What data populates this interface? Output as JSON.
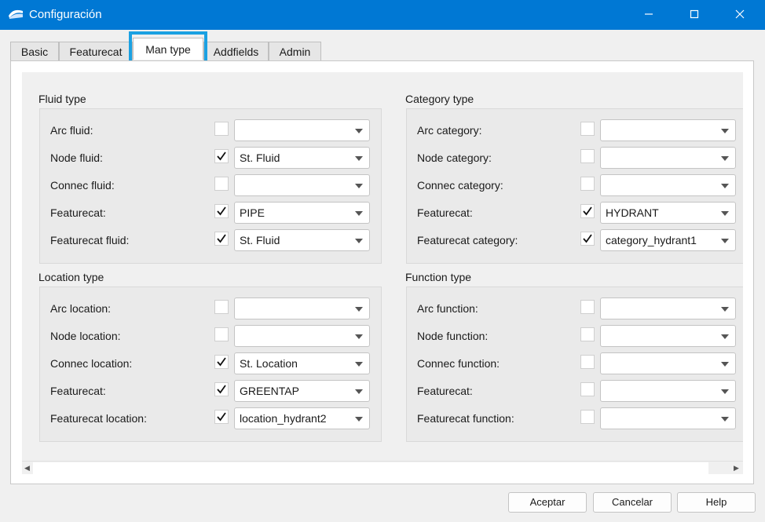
{
  "window": {
    "title": "Configuración",
    "icons": {
      "app": "app-icon",
      "minimize": "minimize-icon",
      "maximize": "maximize-icon",
      "close": "close-icon"
    }
  },
  "tabs": [
    {
      "label": "Basic"
    },
    {
      "label": "Featurecat"
    },
    {
      "label": "Man type",
      "active": true
    },
    {
      "label": "Addfields"
    },
    {
      "label": "Admin"
    }
  ],
  "groups": {
    "fluid": {
      "title": "Fluid type",
      "rows": [
        {
          "label": "Arc fluid:",
          "checked": false,
          "value": ""
        },
        {
          "label": "Node fluid:",
          "checked": true,
          "value": "St. Fluid"
        },
        {
          "label": "Connec fluid:",
          "checked": false,
          "value": ""
        },
        {
          "label": "Featurecat:",
          "checked": true,
          "value": "PIPE"
        },
        {
          "label": "Featurecat fluid:",
          "checked": true,
          "value": "St. Fluid"
        }
      ]
    },
    "category": {
      "title": "Category type",
      "rows": [
        {
          "label": "Arc category:",
          "checked": false,
          "value": ""
        },
        {
          "label": "Node category:",
          "checked": false,
          "value": ""
        },
        {
          "label": "Connec category:",
          "checked": false,
          "value": ""
        },
        {
          "label": "Featurecat:",
          "checked": true,
          "value": "HYDRANT"
        },
        {
          "label": "Featurecat category:",
          "checked": true,
          "value": "category_hydrant1"
        }
      ]
    },
    "location": {
      "title": "Location type",
      "rows": [
        {
          "label": "Arc location:",
          "checked": false,
          "value": ""
        },
        {
          "label": "Node location:",
          "checked": false,
          "value": ""
        },
        {
          "label": "Connec location:",
          "checked": true,
          "value": "St. Location"
        },
        {
          "label": "Featurecat:",
          "checked": true,
          "value": "GREENTAP"
        },
        {
          "label": "Featurecat location:",
          "checked": true,
          "value": "location_hydrant2"
        }
      ]
    },
    "function": {
      "title": "Function type",
      "rows": [
        {
          "label": "Arc function:",
          "checked": false,
          "value": ""
        },
        {
          "label": "Node function:",
          "checked": false,
          "value": ""
        },
        {
          "label": "Connec function:",
          "checked": false,
          "value": ""
        },
        {
          "label": "Featurecat:",
          "checked": false,
          "value": ""
        },
        {
          "label": "Featurecat function:",
          "checked": false,
          "value": ""
        }
      ]
    }
  },
  "buttons": {
    "accept": "Aceptar",
    "cancel": "Cancelar",
    "help": "Help"
  },
  "colors": {
    "titlebar": "#0078d4",
    "highlight": "#1ba1e2"
  }
}
